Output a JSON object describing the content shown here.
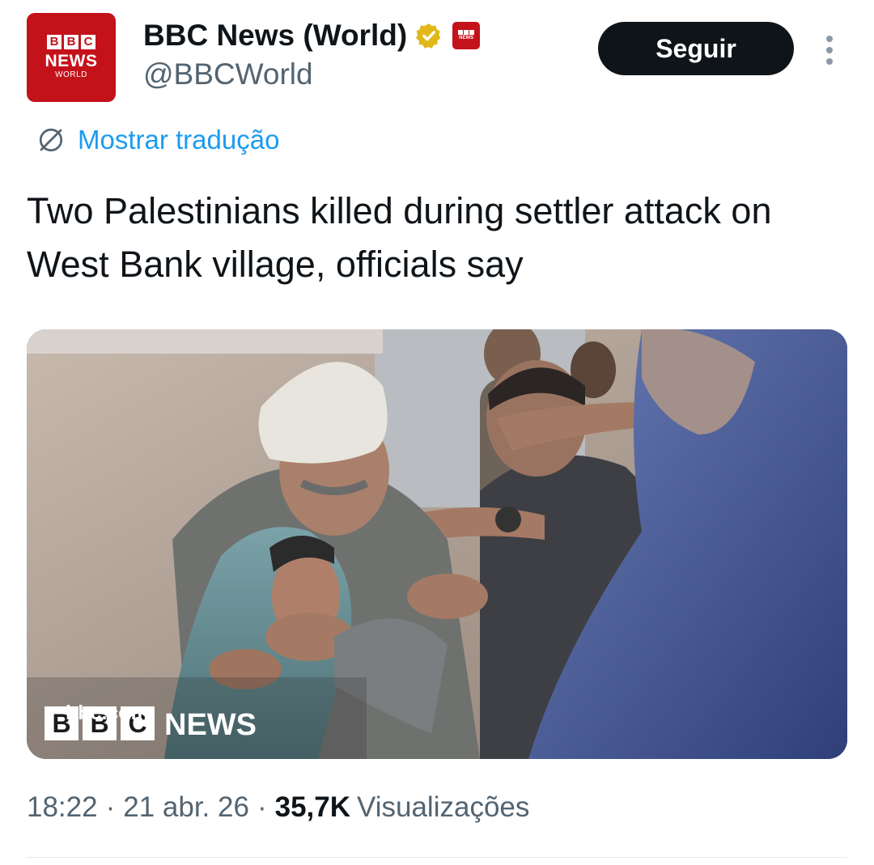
{
  "account": {
    "display_name": "BBC News (World)",
    "handle": "@BBCWorld",
    "avatar": {
      "blocks": [
        "B",
        "B",
        "C"
      ],
      "line1": "NEWS",
      "line2": "WORLD"
    },
    "verified_badge_color": "#e2b719",
    "affiliate_badge_color": "#c4121b"
  },
  "follow_button": {
    "label": "Seguir"
  },
  "more_button": {
    "icon": "more-vertical-icon"
  },
  "translate": {
    "icon": "globe-icon",
    "label": "Mostrar tradução"
  },
  "tweet": {
    "text": "Two Palestinians killed during settler attack on West Bank village, officials say"
  },
  "media": {
    "watermark_site": "bbc.com",
    "watermark_blocks": [
      "B",
      "B",
      "C"
    ],
    "watermark_brand": "NEWS"
  },
  "meta": {
    "time": "18:22",
    "date": "21 abr. 26",
    "views_count": "35,7K",
    "views_label": "Visualizações",
    "separator": "·"
  },
  "colors": {
    "link_blue": "#1d9bf0",
    "secondary_text": "#536471",
    "primary_text": "#0f1419",
    "bbc_red": "#c4121b"
  }
}
